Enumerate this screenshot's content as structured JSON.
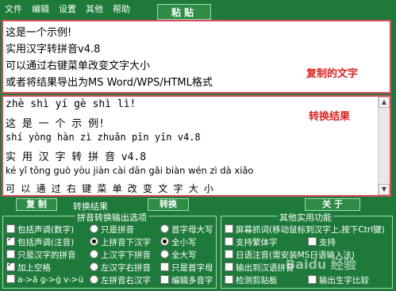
{
  "menu": [
    "文件",
    "编辑",
    "设置",
    "其他",
    "帮助"
  ],
  "paste_button": "粘贴",
  "source_lines": [
    "这是一个示例!",
    "实用汉字转拼音v4.8",
    "可以通过右键菜单改变文字大小",
    "或者将结果导出为MS Word/WPS/HTML格式"
  ],
  "source_label": "复制的文字",
  "result_lines": [
    "zhè shì yí gè shì lì!",
    "这 是 一 个 示 例!",
    "shí yòng hàn zì zhuǎn pīn yīn v4.8",
    "实 用  汉 字 转   拼 音 v4.8",
    "ké yǐ tōng guò yòu jiàn cài dān gǎi biàn wén zì dà xiǎo",
    "可 以 通  过 右  键  菜 单 改 变  文 字 大 小"
  ],
  "result_label": "转换结果",
  "buttons": {
    "copy": "复 制",
    "convert_label": "转换结果",
    "convert": "转换",
    "about": "关 于"
  },
  "group1": {
    "title": "拼音转换输出选项",
    "col1": [
      {
        "t": "包括声调(数字)",
        "c": false
      },
      {
        "t": "包括声调(注音)",
        "c": true
      },
      {
        "t": "只是汉字的拼音",
        "c": false
      },
      {
        "t": "加上空格",
        "c": true
      },
      {
        "t": "a->ā g->ġ v->ü",
        "c": false
      }
    ],
    "col2": [
      {
        "t": "只是拼音",
        "c": false
      },
      {
        "t": "上拼音下汉字",
        "c": true
      },
      {
        "t": "上汉字下拼音",
        "c": false
      },
      {
        "t": "左汉字右拼音",
        "c": false
      },
      {
        "t": "左拼音右汉字",
        "c": false
      }
    ],
    "col3": [
      {
        "t": "首字母大写",
        "c": false,
        "r": true
      },
      {
        "t": "全小写",
        "c": true,
        "r": true
      },
      {
        "t": "全大写",
        "c": false,
        "r": true
      },
      {
        "t": "只是首字母",
        "c": false,
        "r": false
      },
      {
        "t": "编辑多音字",
        "c": false,
        "r": false
      }
    ]
  },
  "group2": {
    "title": "其他实用功能",
    "items": [
      {
        "t": "屏幕抓词(移动鼠标到汉字上,按下Ctrl键)",
        "c": false
      },
      {
        "t": "支持繁体字",
        "c": false
      },
      {
        "t": "日语注音(需安装MS日语输入法)",
        "c": false
      },
      {
        "t": "输出到汉语拼音",
        "c": false
      },
      {
        "t": "检测剪贴板",
        "c": false
      }
    ],
    "extra": [
      {
        "t": "支持",
        "c": false
      },
      {
        "t": "输出生字比较",
        "c": false
      }
    ]
  },
  "watermark": "Baidu 经验"
}
